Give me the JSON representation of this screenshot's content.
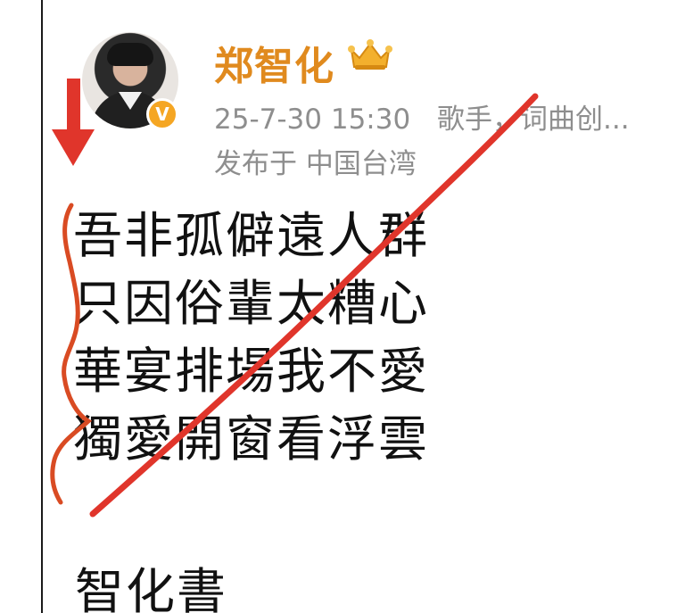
{
  "post": {
    "author": {
      "name": "郑智化",
      "avatar": "avatar-photo",
      "verified_badge": "V",
      "member_badge": "crown-icon"
    },
    "meta": {
      "timestamp": "25-7-30 15:30",
      "description": "歌手，词曲创...",
      "location": "发布于 中国台湾"
    },
    "content": {
      "lines": [
        "吾非孤僻遠人群",
        "只因俗輩太糟心",
        "華宴排場我不愛",
        "獨愛開窗看浮雲"
      ],
      "signature": "智化書"
    }
  },
  "annotations": {
    "arrow_color": "#e0352b",
    "cross_color": "#e0352b",
    "brace_color": "#d94b23"
  },
  "colors": {
    "author_name": "#e08a1e",
    "meta_text": "#8e8e8e",
    "body_text": "#111111",
    "badge": "#f5a623"
  }
}
